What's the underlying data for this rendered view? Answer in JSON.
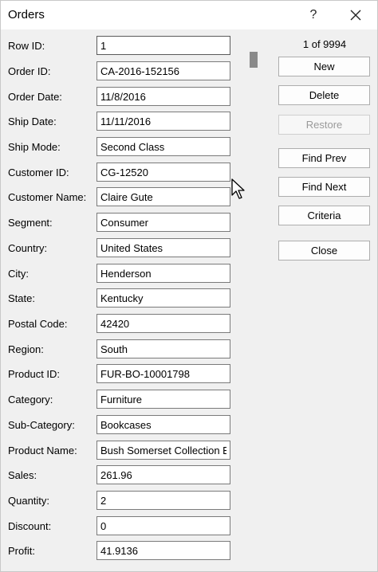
{
  "window": {
    "title": "Orders",
    "help": "?"
  },
  "record_counter": "1 of 9994",
  "buttons": [
    {
      "label": "New",
      "enabled": true
    },
    {
      "label": "Delete",
      "enabled": true
    },
    {
      "label": "Restore",
      "enabled": false
    },
    {
      "label": "Find Prev",
      "enabled": true
    },
    {
      "label": "Find Next",
      "enabled": true
    },
    {
      "label": "Criteria",
      "enabled": true
    },
    {
      "label": "Close",
      "enabled": true
    }
  ],
  "fields": [
    {
      "label": "Row ID:",
      "value": "1"
    },
    {
      "label": "Order ID:",
      "value": "CA-2016-152156"
    },
    {
      "label": "Order Date:",
      "value": "11/8/2016"
    },
    {
      "label": "Ship Date:",
      "value": "11/11/2016"
    },
    {
      "label": "Ship Mode:",
      "value": "Second Class"
    },
    {
      "label": "Customer ID:",
      "value": "CG-12520"
    },
    {
      "label": "Customer Name:",
      "value": "Claire Gute"
    },
    {
      "label": "Segment:",
      "value": "Consumer"
    },
    {
      "label": "Country:",
      "value": "United States"
    },
    {
      "label": "City:",
      "value": "Henderson"
    },
    {
      "label": "State:",
      "value": "Kentucky"
    },
    {
      "label": "Postal Code:",
      "value": "42420"
    },
    {
      "label": "Region:",
      "value": "South"
    },
    {
      "label": "Product ID:",
      "value": "FUR-BO-10001798"
    },
    {
      "label": "Category:",
      "value": "Furniture"
    },
    {
      "label": "Sub-Category:",
      "value": "Bookcases"
    },
    {
      "label": "Product Name:",
      "value": "Bush Somerset Collection Boo"
    },
    {
      "label": "Sales:",
      "value": "261.96"
    },
    {
      "label": "Quantity:",
      "value": "2"
    },
    {
      "label": "Discount:",
      "value": "0"
    },
    {
      "label": "Profit:",
      "value": "41.9136"
    }
  ]
}
